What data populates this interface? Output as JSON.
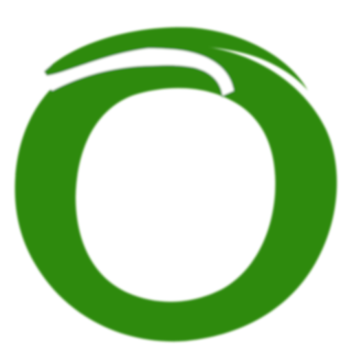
{
  "logo": {
    "icon": "swirl-ring-logo-icon",
    "color": "#2e8a0e",
    "background": "#ffffff"
  }
}
